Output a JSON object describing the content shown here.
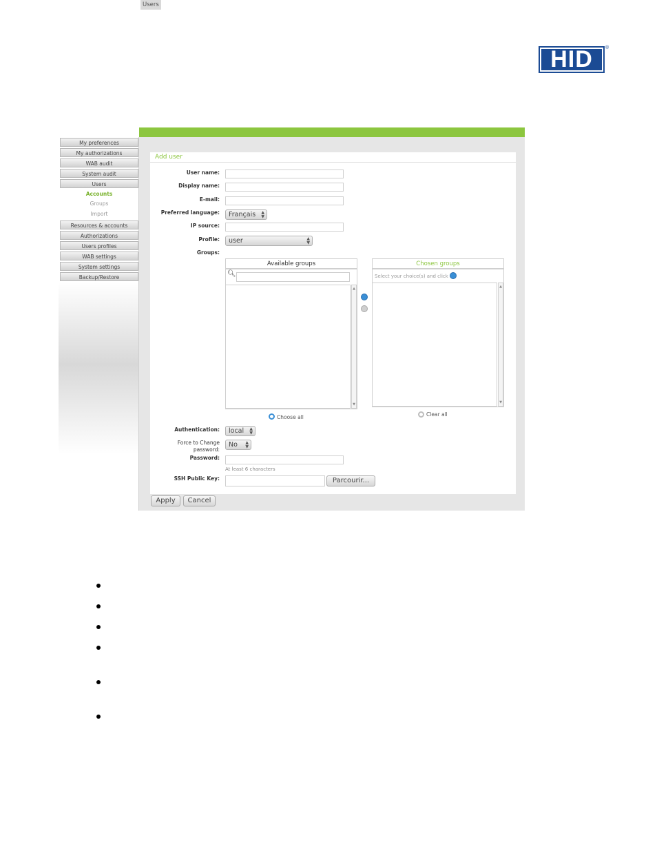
{
  "logo": {
    "text": "HID",
    "reg": "®"
  },
  "breadcrumb": {
    "parent": "Users",
    "current": "Accounts"
  },
  "sidebar": {
    "items": [
      "My preferences",
      "My authorizations",
      "WAB audit",
      "System audit",
      "Users"
    ],
    "sub_items": [
      "Accounts",
      "Groups",
      "Import"
    ],
    "items_after": [
      "Resources & accounts",
      "Authorizations",
      "Users profiles",
      "WAB settings",
      "System settings",
      "Backup/Restore"
    ]
  },
  "form": {
    "title": "Add user",
    "user_name_label": "User name:",
    "display_name_label": "Display name:",
    "email_label": "E-mail:",
    "language_label": "Preferred language:",
    "language_value": "Français",
    "ip_source_label": "IP source:",
    "profile_label": "Profile:",
    "profile_value": "user",
    "groups_label": "Groups:",
    "available_groups": "Available groups",
    "chosen_groups": "Chosen groups",
    "chosen_hint": "Select your choice(s) and click",
    "choose_all": "Choose all",
    "clear_all": "Clear all",
    "authentication_label": "Authentication:",
    "authentication_value": "local",
    "force_change_label_1": "Force to Change",
    "force_change_label_2": "password:",
    "force_change_value": "No",
    "password_label": "Password:",
    "password_hint": "At least 6 characters",
    "ssh_label": "SSH Public Key:",
    "browse_button": "Parcourir...",
    "apply_button": "Apply",
    "cancel_button": "Cancel"
  },
  "colors": {
    "accent": "#8cc63f",
    "brand": "#1b4b94"
  }
}
